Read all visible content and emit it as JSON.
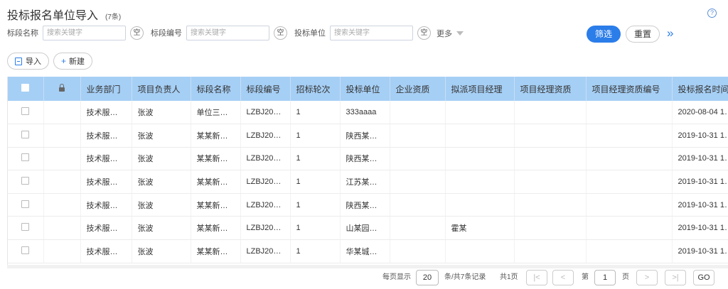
{
  "header": {
    "title": "投标报名单位导入",
    "count": "(7条)",
    "help_icon": "question-circle-icon"
  },
  "filters": {
    "section_label": "标段名称",
    "section_placeholder": "搜索关键字",
    "code_label": "标段编号",
    "code_placeholder": "搜索关键字",
    "unit_label": "投标单位",
    "unit_placeholder": "搜索关键字",
    "clear_label": "空",
    "more_label": "更多",
    "filter_button": "筛选",
    "reset_button": "重置",
    "expand_icon": "»"
  },
  "toolbar": {
    "import_label": "导入",
    "new_label": "新建",
    "new_icon": "+"
  },
  "table": {
    "columns": [
      "业务部门",
      "项目负责人",
      "标段名称",
      "标段编号",
      "招标轮次",
      "投标单位",
      "企业资质",
      "拟派项目经理",
      "项目经理资质",
      "项目经理资质编号",
      "投标报名时间"
    ],
    "rows": [
      [
        "技术服…",
        "张波",
        "单位三…",
        "LZBJ20…",
        "1",
        "333aaaa",
        "",
        "",
        "",
        "",
        "2020-08-04 1…"
      ],
      [
        "技术服…",
        "张波",
        "某某新…",
        "LZBJ20…",
        "1",
        "陕西某…",
        "",
        "",
        "",
        "",
        "2019-10-31 1…"
      ],
      [
        "技术服…",
        "张波",
        "某某新…",
        "LZBJ20…",
        "1",
        "陕西某…",
        "",
        "",
        "",
        "",
        "2019-10-31 1…"
      ],
      [
        "技术服…",
        "张波",
        "某某新…",
        "LZBJ20…",
        "1",
        "江苏某…",
        "",
        "",
        "",
        "",
        "2019-10-31 1…"
      ],
      [
        "技术服…",
        "张波",
        "某某新…",
        "LZBJ20…",
        "1",
        "陕西某…",
        "",
        "",
        "",
        "",
        "2019-10-31 1…"
      ],
      [
        "技术服…",
        "张波",
        "某某新…",
        "LZBJ20…",
        "1",
        "山某园…",
        "",
        "霍某",
        "",
        "",
        "2019-10-31 1…"
      ],
      [
        "技术服…",
        "张波",
        "某某新…",
        "LZBJ20…",
        "1",
        "华某城…",
        "",
        "",
        "",
        "",
        "2019-10-31 1…"
      ]
    ]
  },
  "pager": {
    "per_page_label": "每页显示",
    "per_page_value": "20",
    "total_label": "条/共7条记录",
    "pages_label": "共1页",
    "page_prefix": "第",
    "page_value": "1",
    "page_suffix": "页",
    "first_icon": "|<",
    "prev_icon": "<",
    "next_icon": ">",
    "last_icon": ">|",
    "go_label": "GO"
  }
}
